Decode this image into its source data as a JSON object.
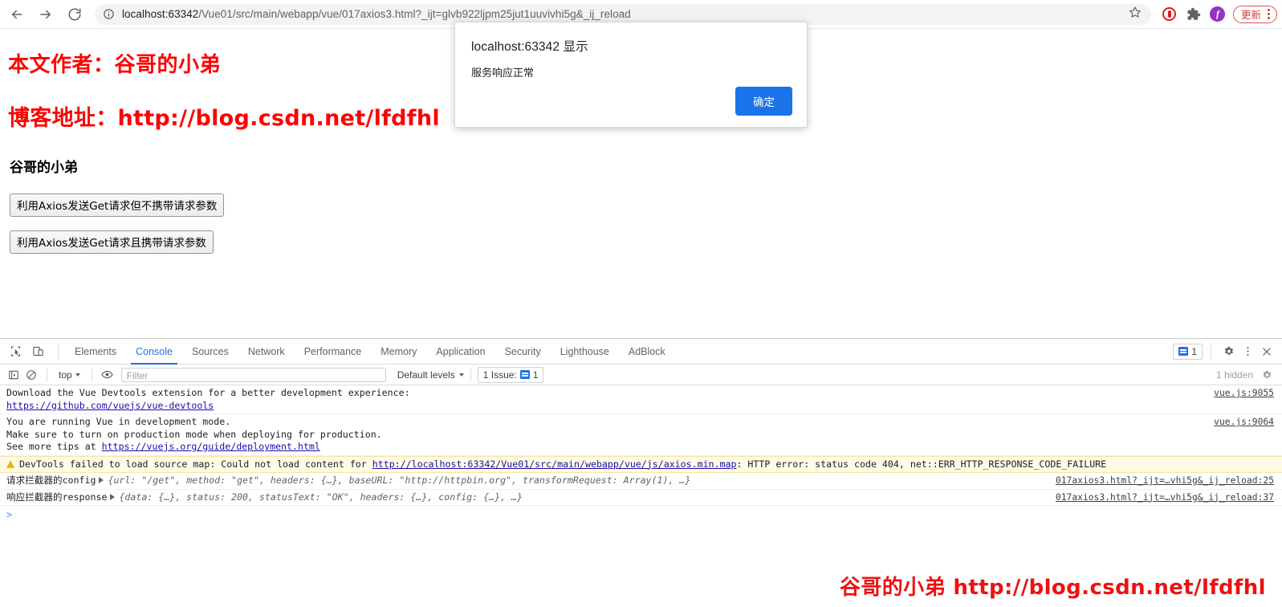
{
  "browser": {
    "back_label": "Back",
    "forward_label": "Forward",
    "reload_label": "Reload",
    "url_host": "localhost:63342",
    "url_path": "/Vue01/src/main/webapp/vue/017axios3.html?_ijt=glvb922ljpm25jut1uuvivhi5g&_ij_reload",
    "star_label": "Bookmark this page",
    "extension_opera": "O",
    "extension_puzzle": "Extensions",
    "profile_initial": "f",
    "update_label": "更新",
    "menu_label": "Customize and control Chrome"
  },
  "page": {
    "author_line": "本文作者：谷哥的小弟",
    "blog_line": "博客地址：http://blog.csdn.net/lfdfhl",
    "subtitle": "谷哥的小弟",
    "button_get_no_params": "利用Axios发送Get请求但不携带请求参数",
    "button_get_with_params": "利用Axios发送Get请求且携带请求参数",
    "watermark": "谷哥的小弟 http://blog.csdn.net/lfdfhl"
  },
  "dialog": {
    "title": "localhost:63342 显示",
    "message": "服务响应正常",
    "ok_label": "确定"
  },
  "devtools": {
    "tabs": [
      {
        "label": "Elements",
        "active": false
      },
      {
        "label": "Console",
        "active": true
      },
      {
        "label": "Sources",
        "active": false
      },
      {
        "label": "Network",
        "active": false
      },
      {
        "label": "Performance",
        "active": false
      },
      {
        "label": "Memory",
        "active": false
      },
      {
        "label": "Application",
        "active": false
      },
      {
        "label": "Security",
        "active": false
      },
      {
        "label": "Lighthouse",
        "active": false
      },
      {
        "label": "AdBlock",
        "active": false
      }
    ],
    "inspect_icon": "inspect-element-icon",
    "device_toggle_icon": "device-toolbar-icon",
    "issues_count": "1",
    "settings_icon": "gear-icon",
    "more_icon": "kebab-menu-icon",
    "close_icon": "close-icon",
    "console": {
      "clear_icon": "clear-console-icon",
      "execute_icon": "execution-context-icon",
      "eye_icon": "live-expression-icon",
      "context": "top",
      "filter_placeholder": "Filter",
      "filter_value": "",
      "levels_label": "Default levels",
      "issues_label": "1 Issue:",
      "issues_badge": "1",
      "hidden_label": "1 hidden",
      "settings_icon": "gear-icon",
      "prompt": ">"
    },
    "messages": [
      {
        "type": "log",
        "lines": [
          "Download the Vue Devtools extension for a better development experience:",
          "https://github.com/vuejs/vue-devtools"
        ],
        "link_line": 1,
        "source": "vue.js:9055"
      },
      {
        "type": "log",
        "lines": [
          "You are running Vue in development mode.",
          "Make sure to turn on production mode when deploying for production.",
          "See more tips at https://vuejs.org/guide/deployment.html"
        ],
        "link_text": "https://vuejs.org/guide/deployment.html",
        "link_prefix": "See more tips at ",
        "source": "vue.js:9064"
      },
      {
        "type": "warning",
        "text_before": "DevTools failed to load source map: Could not load content for ",
        "link_text": "http://localhost:63342/Vue01/src/main/webapp/vue/js/axios.min.map",
        "text_after": ": HTTP error: status code 404, net::ERR_HTTP_RESPONSE_CODE_FAILURE",
        "source": ""
      },
      {
        "type": "object",
        "label_cjk": "请求拦截器的",
        "label_ascii": "config",
        "preview": "{url: \"/get\", method: \"get\", headers: {…}, baseURL: \"http://httpbin.org\", transformRequest: Array(1), …}",
        "source": "017axios3.html?_ijt=…vhi5g&_ij_reload:25"
      },
      {
        "type": "object",
        "label_cjk": "响应拦截器的",
        "label_ascii": "response",
        "preview": "{data: {…}, status: 200, statusText: \"OK\", headers: {…}, config: {…}, …}",
        "source": "017axios3.html?_ijt=…vhi5g&_ij_reload:37"
      }
    ]
  }
}
